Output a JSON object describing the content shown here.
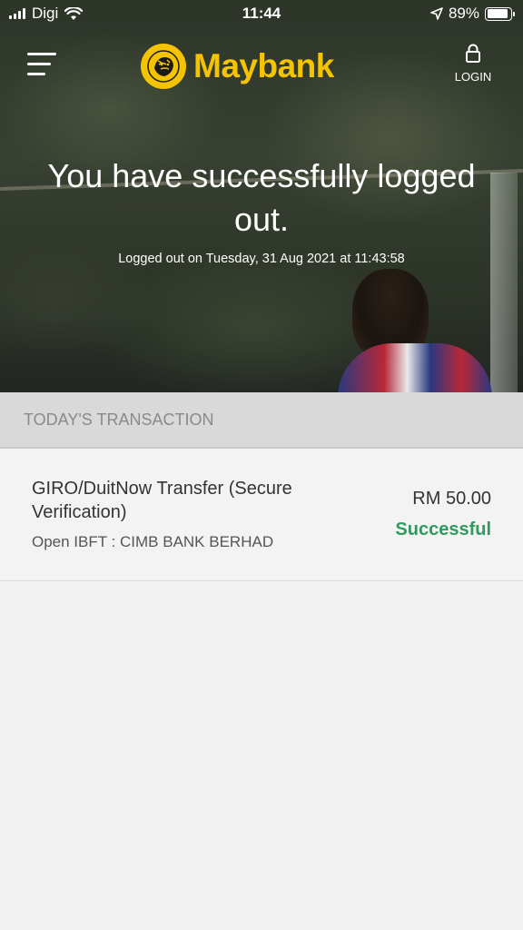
{
  "status_bar": {
    "carrier": "Digi",
    "time": "11:44",
    "battery_percent": "89%",
    "icons": [
      "signal-icon",
      "wifi-icon",
      "location-arrow-icon",
      "battery-icon"
    ]
  },
  "header": {
    "brand": "Maybank",
    "login_label": "LOGIN",
    "brand_color": "#f5c400",
    "icons": [
      "menu-icon",
      "maybank-tiger-logo",
      "lock-icon"
    ]
  },
  "hero": {
    "headline": "You have successfully logged out.",
    "logout_time": "Logged out on Tuesday, 31 Aug 2021 at 11:43:58"
  },
  "transactions": {
    "section_title": "TODAY'S TRANSACTION",
    "items": [
      {
        "title": "GIRO/DuitNow Transfer (Secure Verification)",
        "subtitle": "Open IBFT : CIMB BANK BERHAD",
        "amount": "RM 50.00",
        "status": "Successful",
        "status_color": "#2e9a5e"
      }
    ]
  }
}
